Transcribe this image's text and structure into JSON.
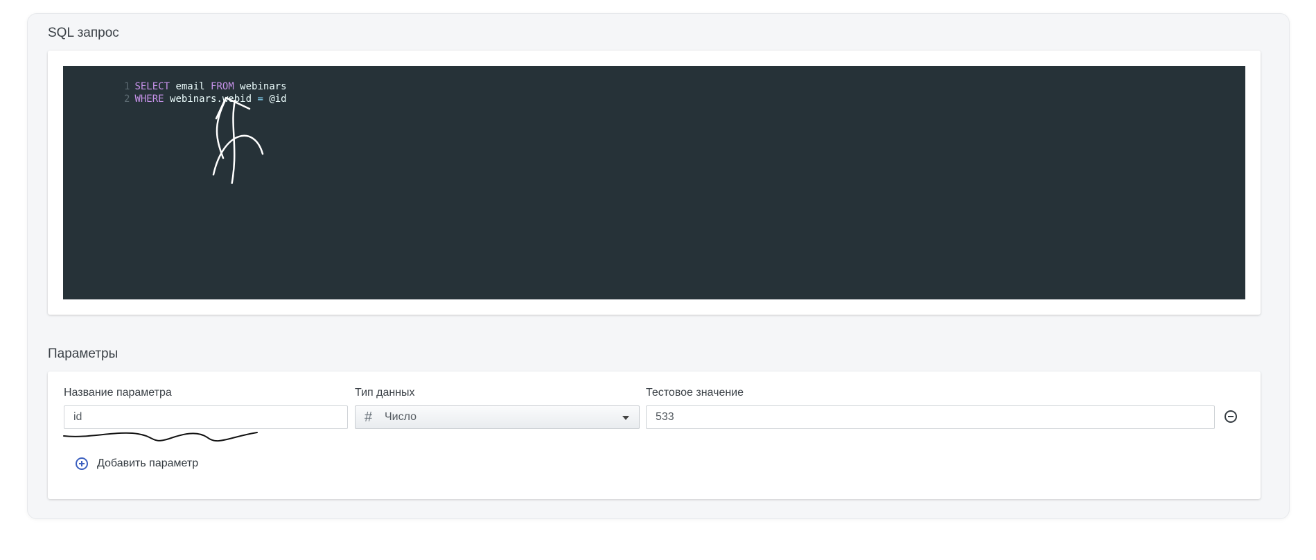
{
  "sql_section": {
    "title": "SQL запрос",
    "code_lines": [
      {
        "number": "1",
        "tokens": [
          {
            "text": "SELECT",
            "kind": "kw"
          },
          {
            "text": " email ",
            "kind": "id"
          },
          {
            "text": "FROM",
            "kind": "kw"
          },
          {
            "text": " webinars",
            "kind": "id"
          }
        ]
      },
      {
        "number": "2",
        "tokens": [
          {
            "text": "WHERE",
            "kind": "kw"
          },
          {
            "text": " webinars.webid ",
            "kind": "id"
          },
          {
            "text": "=",
            "kind": "op"
          },
          {
            "text": " @id",
            "kind": "id"
          }
        ]
      }
    ],
    "editor_background": "#263238",
    "keyword_color": "#c792ea"
  },
  "params_section": {
    "title": "Параметры",
    "columns": {
      "name": "Название параметра",
      "type": "Тип данных",
      "test_value": "Тестовое значение"
    },
    "rows": [
      {
        "name": "id",
        "type_icon": "hash-icon",
        "type": "Число",
        "test_value": "533"
      }
    ],
    "add_button": "Добавить параметр",
    "accent_color": "#3b5fbf"
  }
}
